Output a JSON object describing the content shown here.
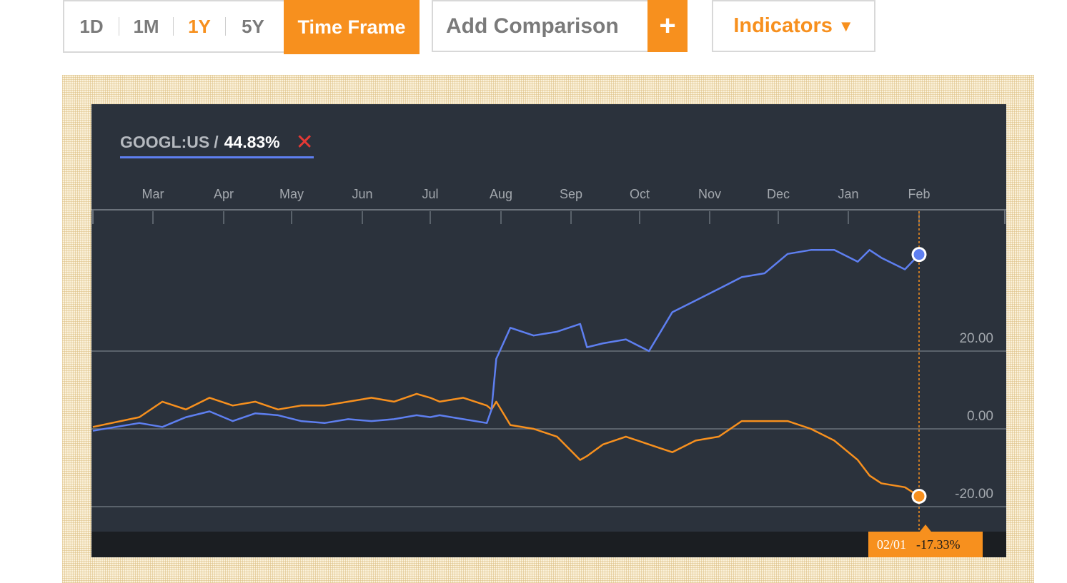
{
  "toolbar": {
    "timeframes": [
      "1D",
      "1M",
      "1Y",
      "5Y"
    ],
    "active_timeframe": "1Y",
    "time_frame_label": "Time Frame",
    "comparison_placeholder": "Add Comparison",
    "add_symbol": "+",
    "indicators_label": "Indicators",
    "indicators_caret": "▼"
  },
  "legend": {
    "ticker": "GOOGL:US",
    "separator": "/",
    "value": "44.83%",
    "remove_symbol": "✕"
  },
  "tooltip": {
    "date": "02/01",
    "value": "-17.33%"
  },
  "colors": {
    "accent": "#f7901e",
    "series_googl": "#5e7ff0",
    "series_comparison": "#f7901e",
    "chart_background": "#2b323c"
  },
  "chart_data": {
    "type": "line",
    "title": "",
    "xlabel": "",
    "ylabel": "",
    "x_tick_labels": [
      "Mar",
      "Apr",
      "May",
      "Jun",
      "Jul",
      "Aug",
      "Sep",
      "Oct",
      "Nov",
      "Dec",
      "Jan",
      "Feb"
    ],
    "y_tick_labels": [
      "20.00",
      "0.00",
      "-20.00"
    ],
    "ylim": [
      -20,
      30
    ],
    "grid": "horizontal",
    "legend_position": "top-left",
    "x": [
      "02/15",
      "02/25",
      "03/05",
      "03/15",
      "03/25",
      "04/05",
      "04/15",
      "04/25",
      "05/05",
      "05/15",
      "05/25",
      "06/05",
      "06/15",
      "06/25",
      "07/01",
      "07/05",
      "07/15",
      "07/25",
      "07/27",
      "07/29",
      "08/05",
      "08/15",
      "08/25",
      "09/05",
      "09/08",
      "09/15",
      "09/25",
      "10/05",
      "10/10",
      "10/15",
      "10/25",
      "11/05",
      "11/15",
      "11/25",
      "12/05",
      "12/15",
      "12/25",
      "01/05",
      "01/10",
      "01/15",
      "01/25",
      "02/01"
    ],
    "series": [
      {
        "name": "GOOGL:US",
        "values": [
          -0.5,
          1.5,
          0.5,
          3,
          4.5,
          2,
          4,
          3.5,
          2,
          1.5,
          2.5,
          2,
          2.5,
          3.5,
          3,
          3.5,
          2.5,
          1.5,
          5,
          18,
          26,
          24,
          25,
          27,
          21,
          22,
          23,
          20,
          25,
          30,
          33,
          36,
          39,
          40,
          45,
          46,
          46,
          43,
          46,
          44,
          41,
          44.83
        ]
      },
      {
        "name": "",
        "values": [
          0.5,
          3,
          7,
          5,
          8,
          6,
          7,
          5,
          6,
          6,
          7,
          8,
          7,
          9,
          8,
          7,
          8,
          6,
          5,
          7,
          1,
          0,
          -2,
          -8,
          -7,
          -4,
          -2,
          -4,
          -5,
          -6,
          -3,
          -2,
          2,
          2,
          2,
          0,
          -3,
          -8,
          -12,
          -14,
          -15,
          -17.33
        ]
      }
    ]
  }
}
